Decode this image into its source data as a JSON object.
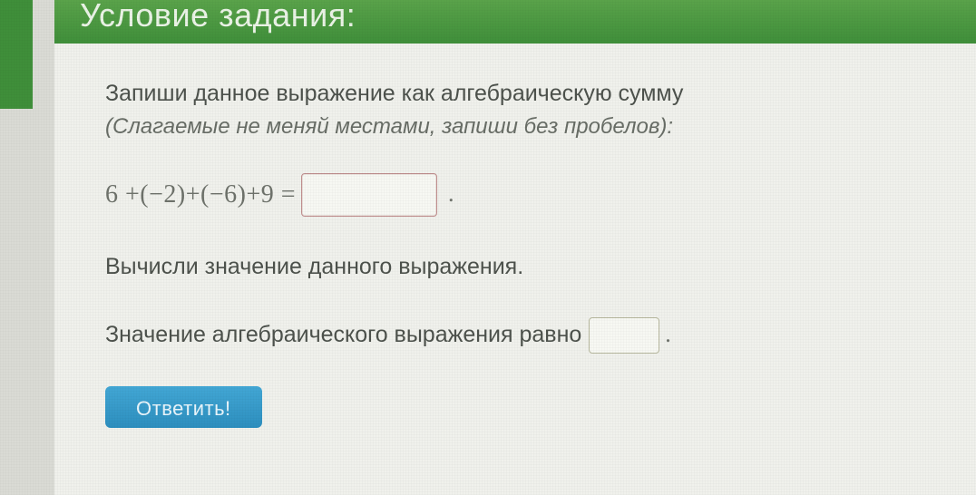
{
  "header": {
    "title": "Условие задания:"
  },
  "task": {
    "instruction_line1": "Запиши данное выражение как алгебраическую сумму",
    "instruction_line2": "(Слагаемые не меняй местами, запиши без пробелов):",
    "expression": "6 +(−2)+(−6)+9 =",
    "compute_prompt": "Вычисли значение данного выражения.",
    "value_prompt": "Значение алгебраического выражения равно",
    "period": "."
  },
  "inputs": {
    "algebraic_sum": "",
    "result_value": ""
  },
  "submit": {
    "label": "Ответить!"
  }
}
